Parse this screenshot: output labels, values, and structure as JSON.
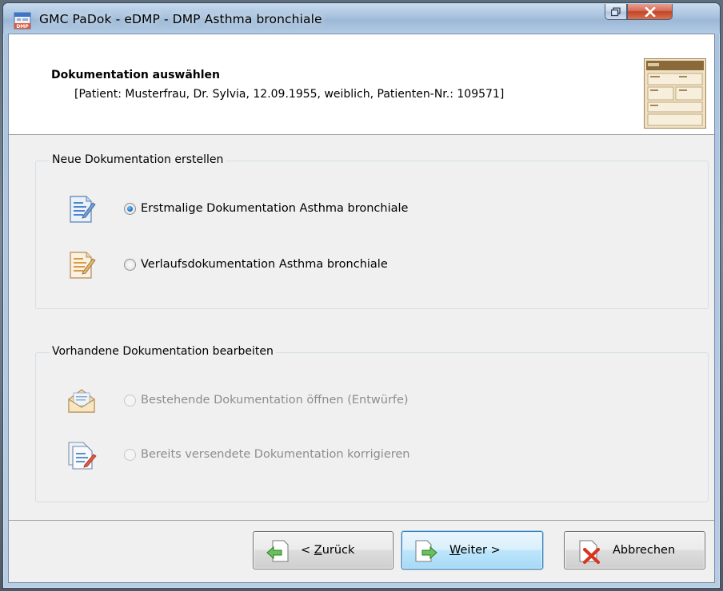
{
  "window": {
    "title": "GMC PaDok - eDMP - DMP Asthma bronchiale",
    "app_icon_text": "DMP",
    "icons": [
      "app-icon",
      "restore-icon",
      "close-icon"
    ]
  },
  "header": {
    "title": "Dokumentation auswählen",
    "patient_info": "[Patient: Musterfrau, Dr. Sylvia, 12.09.1955, weiblich, Patienten-Nr.: 109571]",
    "form_icon": "form-document-icon"
  },
  "new_docs": {
    "group_label": "Neue Dokumentation erstellen",
    "options": [
      {
        "label": "Erstmalige Dokumentation Asthma bronchiale",
        "checked": true,
        "enabled": true,
        "icon": "new-document-icon"
      },
      {
        "label": "Verlaufsdokumentation Asthma bronchiale",
        "checked": false,
        "enabled": true,
        "icon": "followup-document-icon"
      }
    ]
  },
  "existing_docs": {
    "group_label": "Vorhandene Dokumentation bearbeiten",
    "options": [
      {
        "label": "Bestehende Dokumentation öffnen (Entwürfe)",
        "checked": false,
        "enabled": false,
        "icon": "open-envelope-icon"
      },
      {
        "label": "Bereits versendete Dokumentation korrigieren",
        "checked": false,
        "enabled": false,
        "icon": "edit-document-icon"
      }
    ]
  },
  "buttons": {
    "back_prefix": "< ",
    "back_mnemonic": "Z",
    "back_rest": "urück",
    "next_mnemonic": "W",
    "next_rest": "eiter >",
    "cancel": "Abbrechen"
  },
  "colors": {
    "accent": "#1f74c2",
    "disabled_text": "#8d8d8d",
    "cancel_x": "#d8341f"
  }
}
